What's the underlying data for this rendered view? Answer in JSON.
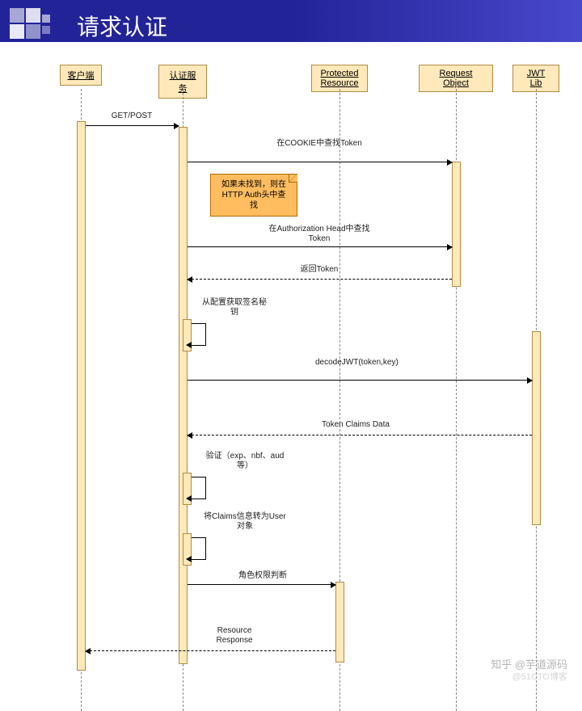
{
  "header": {
    "title": "请求认证"
  },
  "participants": {
    "client": "客户端",
    "authService": "认证服务",
    "protected": "Protected Resource",
    "requestObj": "Request Object",
    "jwtLib": "JWT Lib"
  },
  "messages": {
    "getPost": "GET/POST",
    "cookieLookup": "在COOKIE中查找Token",
    "noteNotFound": "如果未找到，则在HTTP Auth头中查找",
    "authHeadLookup": "在Authorization Head中查找Token",
    "returnToken": "返回Token",
    "getSignKey": "从配置获取签名秘钥",
    "decodeJwt": "decodeJWT(token,key)",
    "tokenClaims": "Token Claims Data",
    "verify": "验证（exp、nbf、aud等）",
    "claimsToUser": "将Claims信息转为User对象",
    "roleCheck": "角色权限判断",
    "resourceResp": "Resource Response"
  },
  "watermark": "知乎 @芋道源码",
  "watermark2": "@51CTO博客"
}
